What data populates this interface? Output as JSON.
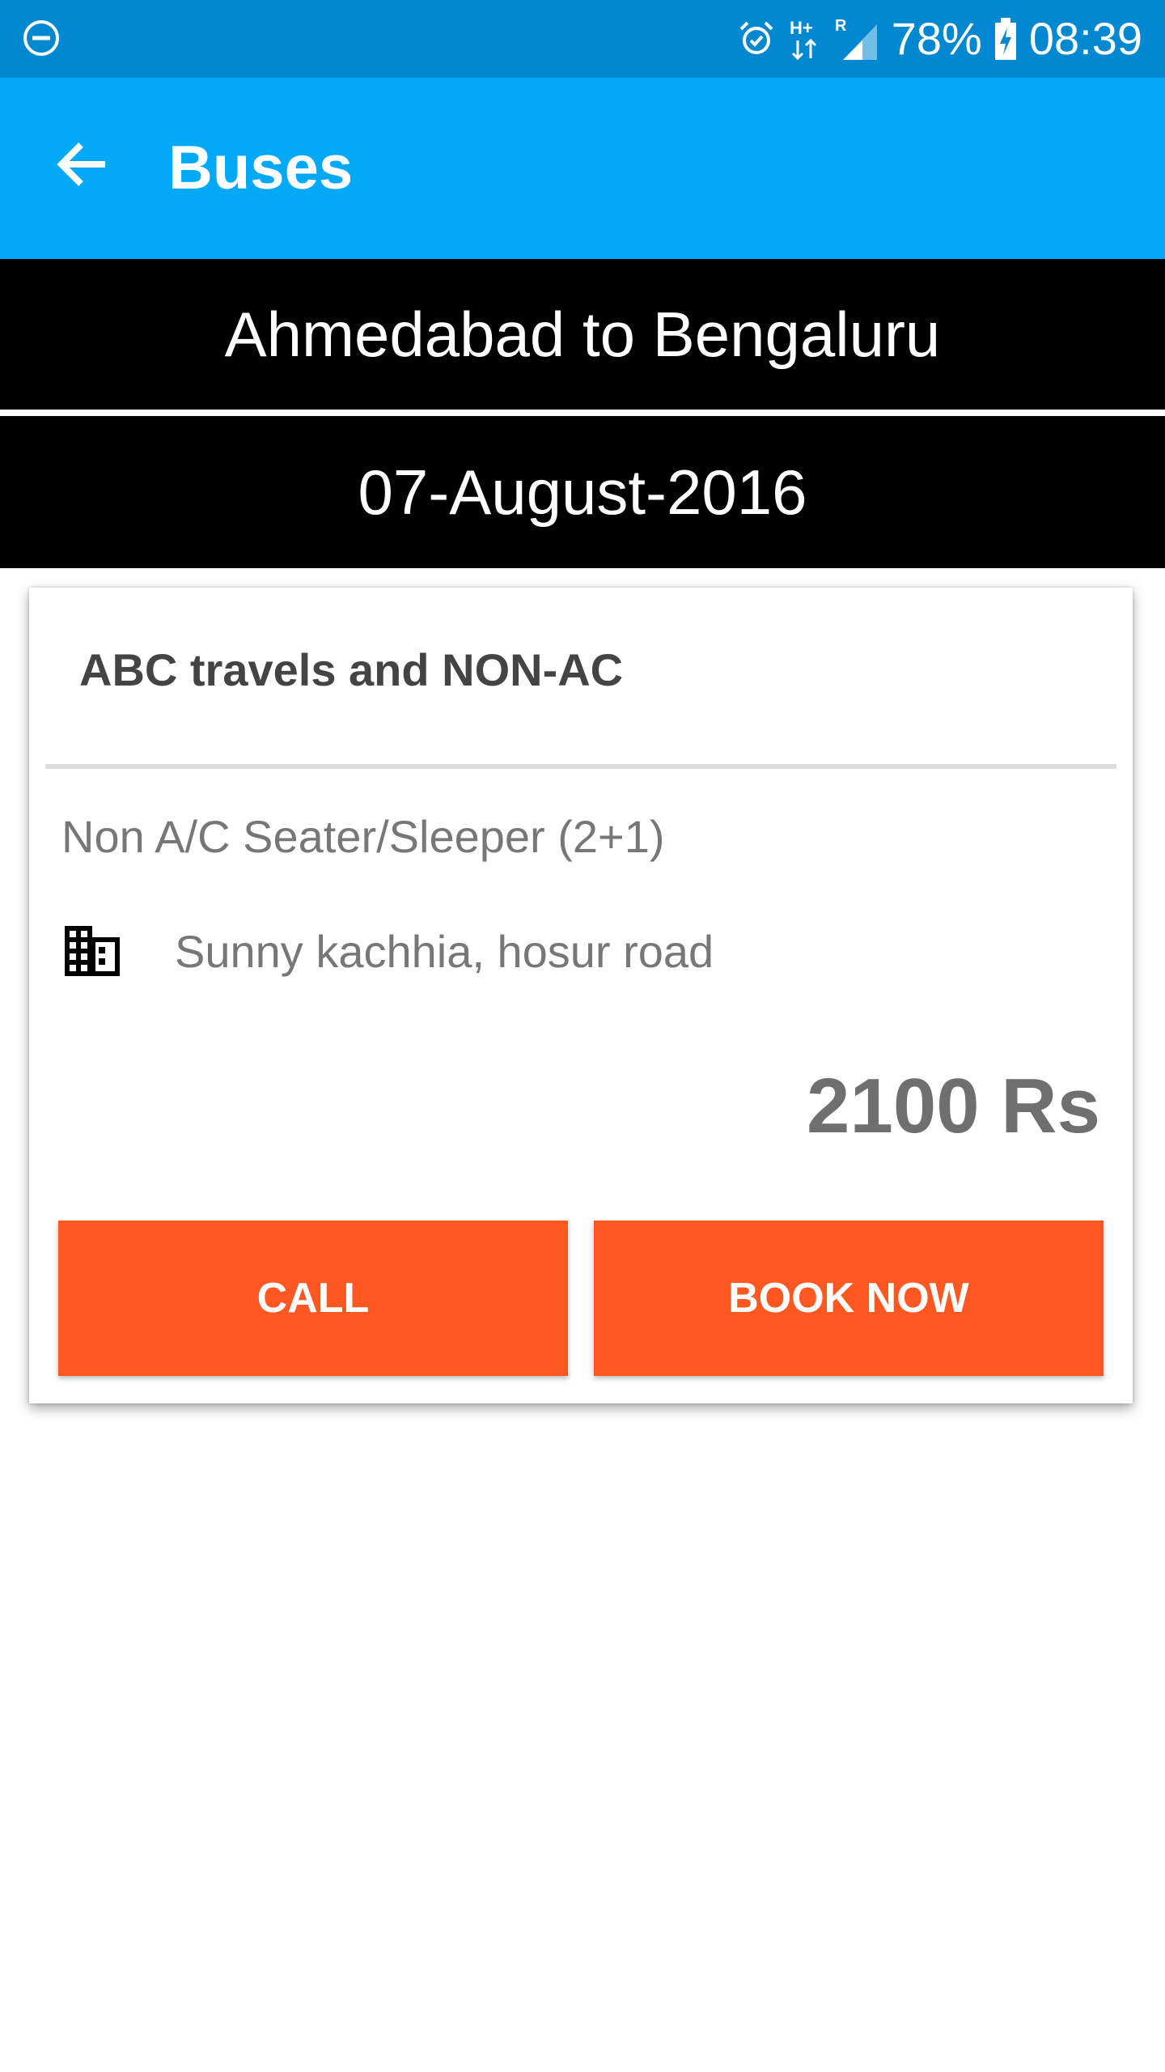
{
  "status_bar": {
    "battery_percent": "78%",
    "time": "08:39",
    "icons": [
      "do-not-disturb-icon",
      "alarm-icon",
      "hplus-data-icon",
      "signal-roaming-icon",
      "battery-charging-icon"
    ],
    "network_label": "H+",
    "roaming_label": "R"
  },
  "app_bar": {
    "title": "Buses",
    "back_icon": "arrow-back-icon"
  },
  "route": {
    "text": "Ahmedabad to Bengaluru"
  },
  "date": {
    "text": "07-August-2016"
  },
  "bus_card": {
    "operator": "ABC travels and NON-AC",
    "bus_type": "Non A/C Seater/Sleeper (2+1)",
    "boarding_icon": "building-icon",
    "boarding_point": "Sunny kachhia, hosur road",
    "price": "2100 Rs",
    "call_label": "CALL",
    "book_label": "BOOK NOW"
  },
  "colors": {
    "status_bar": "#0288d1",
    "app_bar": "#03a9f4",
    "banner": "#000000",
    "accent": "#ff5722"
  }
}
